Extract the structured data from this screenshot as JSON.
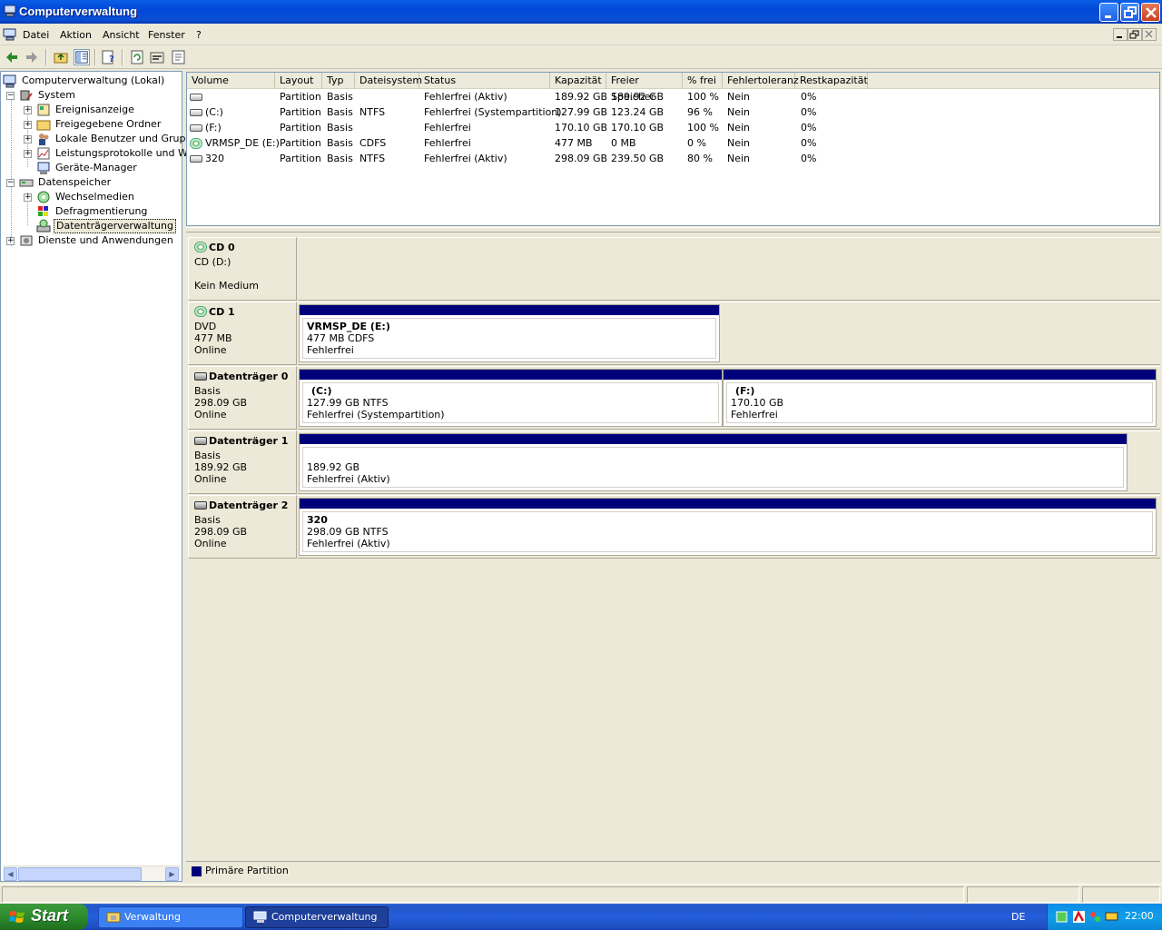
{
  "window": {
    "title": "Computerverwaltung",
    "controls": {
      "minimize": "minimize",
      "maximize": "maximize",
      "close": "close"
    }
  },
  "menubar": {
    "items": [
      "Datei",
      "Aktion",
      "Ansicht",
      "Fenster",
      "?"
    ]
  },
  "toolbar": {
    "buttons": [
      "back-icon",
      "forward-icon",
      "up-folder-icon",
      "show-hide-tree-icon",
      "help-icon",
      "refresh-icon",
      "properties-icon",
      "settings-icon"
    ]
  },
  "tree": {
    "root": "Computerverwaltung (Lokal)",
    "items": [
      {
        "label": "System"
      },
      {
        "label": "Ereignisanzeige"
      },
      {
        "label": "Freigegebene Ordner"
      },
      {
        "label": "Lokale Benutzer und Gruppen"
      },
      {
        "label": "Leistungsprotokolle und Warn"
      },
      {
        "label": "Geräte-Manager"
      },
      {
        "label": "Datenspeicher"
      },
      {
        "label": "Wechselmedien"
      },
      {
        "label": "Defragmentierung"
      },
      {
        "label": "Datenträgerverwaltung"
      },
      {
        "label": "Dienste und Anwendungen"
      }
    ]
  },
  "volumes": {
    "columns": [
      "Volume",
      "Layout",
      "Typ",
      "Dateisystem",
      "Status",
      "Kapazität",
      "Freier Speicher",
      "% frei",
      "Fehlertoleranz",
      "Restkapazität"
    ],
    "rows": [
      [
        "",
        "Partition",
        "Basis",
        "",
        "Fehlerfrei (Aktiv)",
        "189.92 GB",
        "189.92 GB",
        "100 %",
        "Nein",
        "0%"
      ],
      [
        "(C:)",
        "Partition",
        "Basis",
        "NTFS",
        "Fehlerfrei (Systempartition)",
        "127.99 GB",
        "123.24 GB",
        "96 %",
        "Nein",
        "0%"
      ],
      [
        "(F:)",
        "Partition",
        "Basis",
        "",
        "Fehlerfrei",
        "170.10 GB",
        "170.10 GB",
        "100 %",
        "Nein",
        "0%"
      ],
      [
        "VRMSP_DE (E:)",
        "Partition",
        "Basis",
        "CDFS",
        "Fehlerfrei",
        "477 MB",
        "0 MB",
        "0 %",
        "Nein",
        "0%"
      ],
      [
        "320",
        "Partition",
        "Basis",
        "NTFS",
        "Fehlerfrei (Aktiv)",
        "298.09 GB",
        "239.50 GB",
        "80 %",
        "Nein",
        "0%"
      ]
    ]
  },
  "disks": [
    {
      "title": "CD 0",
      "lines": [
        "CD (D:)",
        "",
        "Kein Medium"
      ]
    },
    {
      "title": "CD 1",
      "lines": [
        "DVD",
        "477 MB",
        "Online"
      ],
      "partitions": [
        {
          "name": "VRMSP_DE  (E:)",
          "size": "477 MB CDFS",
          "status": "Fehlerfrei"
        }
      ]
    },
    {
      "title": "Datenträger 0",
      "lines": [
        "Basis",
        "298.09 GB",
        "Online"
      ],
      "partitions": [
        {
          "name": "(C:)",
          "size": "127.99 GB NTFS",
          "status": "Fehlerfrei (Systempartition)"
        },
        {
          "name": "(F:)",
          "size": "170.10 GB",
          "status": "Fehlerfrei"
        }
      ]
    },
    {
      "title": "Datenträger 1",
      "lines": [
        "Basis",
        "189.92 GB",
        "Online"
      ],
      "partitions": [
        {
          "name": "",
          "size": "189.92 GB",
          "status": "Fehlerfrei (Aktiv)"
        }
      ]
    },
    {
      "title": "Datenträger 2",
      "lines": [
        "Basis",
        "298.09 GB",
        "Online"
      ],
      "partitions": [
        {
          "name": "320",
          "size": "298.09 GB NTFS",
          "status": "Fehlerfrei (Aktiv)"
        }
      ]
    }
  ],
  "legend": {
    "label": "Primäre Partition",
    "color": "#00007b"
  },
  "taskbar": {
    "start": "Start",
    "tasks": [
      {
        "label": "Verwaltung"
      },
      {
        "label": "Computerverwaltung"
      }
    ],
    "language": "DE",
    "clock": "22:00"
  }
}
